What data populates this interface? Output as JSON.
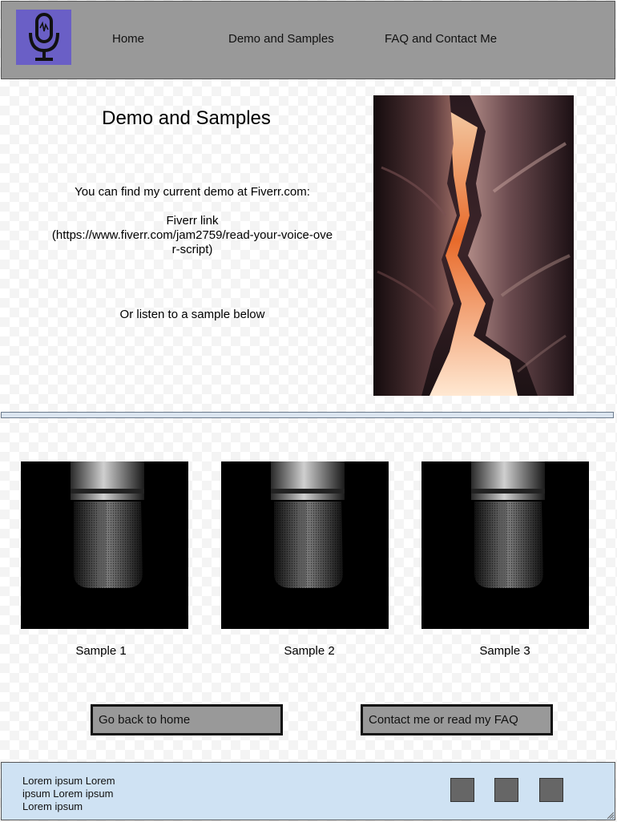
{
  "nav": {
    "home": "Home",
    "demo": "Demo and Samples",
    "faq": "FAQ and Contact Me"
  },
  "logo": {
    "icon": "microphone-icon",
    "bg": "#6a5fc6"
  },
  "intro": {
    "title": "Demo and Samples",
    "find_demo": "You can find my current demo at Fiverr.com:",
    "fiverr_line1": "Fiverr link",
    "fiverr_line2": "(https://www.fiverr.com/jam2759/read-your-voice-ove",
    "fiverr_line3": "r-script)",
    "listen": "Or listen to a sample below"
  },
  "samples": [
    {
      "label": "Sample 1"
    },
    {
      "label": "Sample 2"
    },
    {
      "label": "Sample 3"
    }
  ],
  "buttons": {
    "home": "Go back to home",
    "contact": "Contact me or read my FAQ"
  },
  "footer": {
    "text": "Lorem ipsum Lorem ipsum Lorem ipsum Lorem ipsum",
    "social_color": "#666666"
  },
  "colors": {
    "header_bg": "#999999",
    "footer_bg": "#cfe2f3",
    "button_bg": "#999999"
  }
}
